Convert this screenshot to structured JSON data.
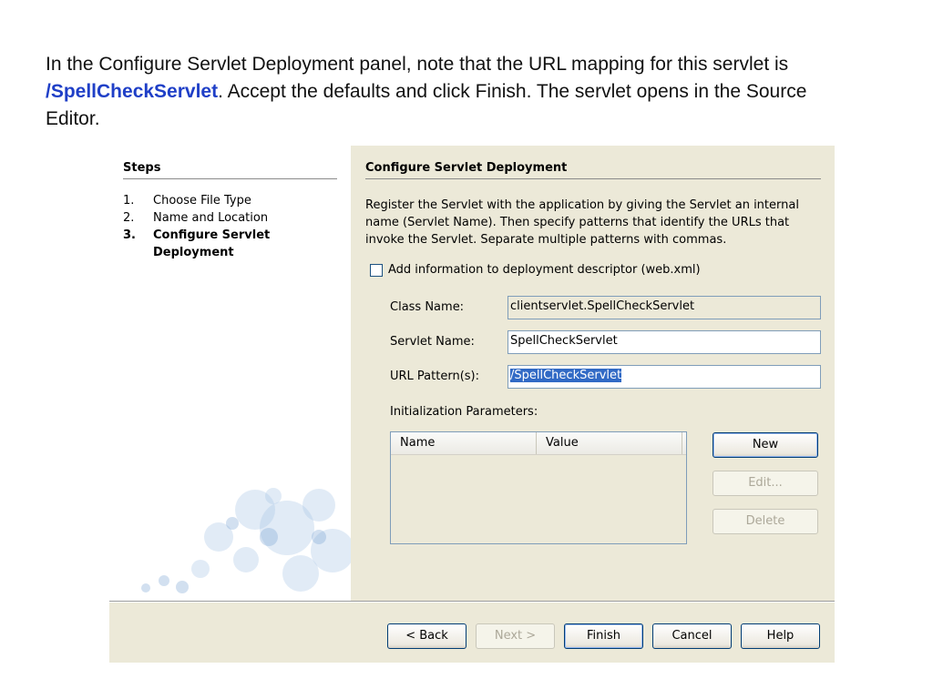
{
  "slide": {
    "line1": "In the Configure Servlet Deployment panel, note that the URL mapping for this servlet is",
    "highlight": "/SpellCheckServlet",
    "line2_rest": ". Accept the defaults and click Finish. The servlet opens in the Source",
    "line3": "Editor."
  },
  "steps": {
    "title": "Steps",
    "items": [
      {
        "num": "1.",
        "label": "Choose File Type"
      },
      {
        "num": "2.",
        "label": "Name and Location"
      },
      {
        "num": "3.",
        "label": "Configure Servlet Deployment"
      }
    ]
  },
  "panel": {
    "title": "Configure Servlet Deployment",
    "description": "Register the Servlet with the application by giving the Servlet an internal name (Servlet Name). Then specify patterns that identify the URLs that invoke the Servlet. Separate multiple patterns with commas.",
    "checkbox_label": "Add information to deployment descriptor (web.xml)",
    "class_name_label": "Class Name:",
    "class_name_value": "clientservlet.SpellCheckServlet",
    "servlet_name_label": "Servlet Name:",
    "servlet_name_value": "SpellCheckServlet",
    "url_pattern_label": "URL Pattern(s):",
    "url_pattern_value": "/SpellCheckServlet",
    "init_params_label": "Initialization Parameters:",
    "table_columns": [
      "Name",
      "Value"
    ],
    "new_label": "New",
    "edit_label": "Edit...",
    "delete_label": "Delete"
  },
  "footer": {
    "back_label": "< Back",
    "next_label": "Next >",
    "finish_label": "Finish",
    "cancel_label": "Cancel",
    "help_label": "Help"
  },
  "colors": {
    "highlight_text": "#1f3fc7",
    "selection": "#316ac5",
    "dialog_bg": "#ece9d8"
  }
}
